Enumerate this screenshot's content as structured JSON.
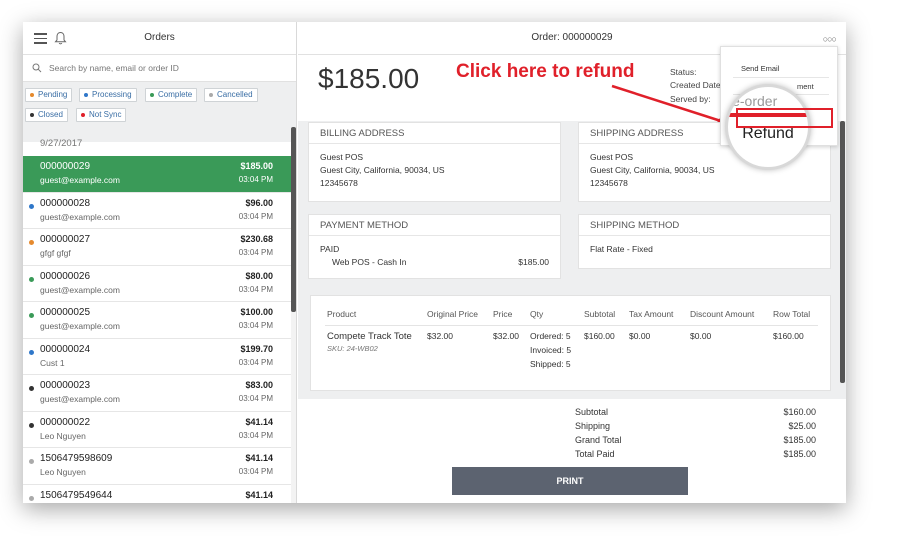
{
  "left": {
    "title": "Orders",
    "search_placeholder": "Search by name, email or order ID",
    "filters": [
      {
        "label": "Pending",
        "color": "#e58a2e"
      },
      {
        "label": "Processing",
        "color": "#2f77c9"
      },
      {
        "label": "Complete",
        "color": "#3a9a58"
      },
      {
        "label": "Cancelled",
        "color": "#aaaaaa"
      },
      {
        "label": "Closed",
        "color": "#333333"
      },
      {
        "label": "Not Sync",
        "color": "#e0202a"
      }
    ],
    "date": "9/27/2017",
    "orders": [
      {
        "id": "000000029",
        "customer": "guest@example.com",
        "amount": "$185.00",
        "time": "03:04 PM",
        "dot": "#3a9a58",
        "active": true
      },
      {
        "id": "000000028",
        "customer": "guest@example.com",
        "amount": "$96.00",
        "time": "03:04 PM",
        "dot": "#2f77c9"
      },
      {
        "id": "000000027",
        "customer": "gfgf gfgf",
        "amount": "$230.68",
        "time": "03:04 PM",
        "dot": "#e58a2e"
      },
      {
        "id": "000000026",
        "customer": "guest@example.com",
        "amount": "$80.00",
        "time": "03:04 PM",
        "dot": "#3a9a58"
      },
      {
        "id": "000000025",
        "customer": "guest@example.com",
        "amount": "$100.00",
        "time": "03:04 PM",
        "dot": "#3a9a58"
      },
      {
        "id": "000000024",
        "customer": "Cust 1",
        "amount": "$199.70",
        "time": "03:04 PM",
        "dot": "#2f77c9"
      },
      {
        "id": "000000023",
        "customer": "guest@example.com",
        "amount": "$83.00",
        "time": "03:04 PM",
        "dot": "#333333"
      },
      {
        "id": "000000022",
        "customer": "Leo Nguyen",
        "amount": "$41.14",
        "time": "03:04 PM",
        "dot": "#333333"
      },
      {
        "id": "1506479598609",
        "customer": "Leo Nguyen",
        "amount": "$41.14",
        "time": "03:04 PM",
        "dot": "#aaaaaa"
      },
      {
        "id": "1506479549644",
        "customer": "",
        "amount": "$41.14",
        "time": "",
        "dot": "#aaaaaa"
      }
    ]
  },
  "right": {
    "title": "Order: 000000029",
    "grand_total": "$185.00",
    "callout": "Click here to refund",
    "meta": {
      "status": "Status:",
      "created": "Created Date:",
      "served": "Served by:"
    },
    "billing": {
      "title": "BILLING ADDRESS",
      "lines": [
        "Guest POS",
        "Guest City, California, 90034, US",
        "12345678"
      ]
    },
    "shipping": {
      "title": "SHIPPING ADDRESS",
      "lines": [
        "Guest POS",
        "Guest City, California, 90034, US",
        "12345678"
      ]
    },
    "payment": {
      "title": "PAYMENT METHOD",
      "status": "PAID",
      "method": "Web POS - Cash In",
      "amount": "$185.00"
    },
    "shipping_method": {
      "title": "SHIPPING METHOD",
      "value": "Flat Rate - Fixed"
    },
    "items": {
      "headers": [
        "Product",
        "Original Price",
        "Price",
        "Qty",
        "Subtotal",
        "Tax Amount",
        "Discount Amount",
        "Row Total"
      ],
      "row": {
        "product": "Compete Track Tote",
        "sku": "SKU: 24-WB02",
        "original_price": "$32.00",
        "price": "$32.00",
        "qty_ordered": "Ordered: 5",
        "qty_invoiced": "Invoiced: 5",
        "qty_shipped": "Shipped: 5",
        "subtotal": "$160.00",
        "tax": "$0.00",
        "discount": "$0.00",
        "row_total": "$160.00"
      }
    },
    "totals": [
      {
        "label": "Subtotal",
        "value": "$160.00"
      },
      {
        "label": "Shipping",
        "value": "$25.00"
      },
      {
        "label": "Grand Total",
        "value": "$185.00"
      },
      {
        "label": "Total Paid",
        "value": "$185.00"
      }
    ],
    "print_label": "PRINT"
  },
  "dropdown": {
    "send_email": "Send Email",
    "partial": "ment",
    "ghost": "Re-order",
    "refund": "Refund"
  },
  "colors": {
    "active_row": "#3a9a58",
    "callout": "#e0202a",
    "print": "#5c6370"
  }
}
